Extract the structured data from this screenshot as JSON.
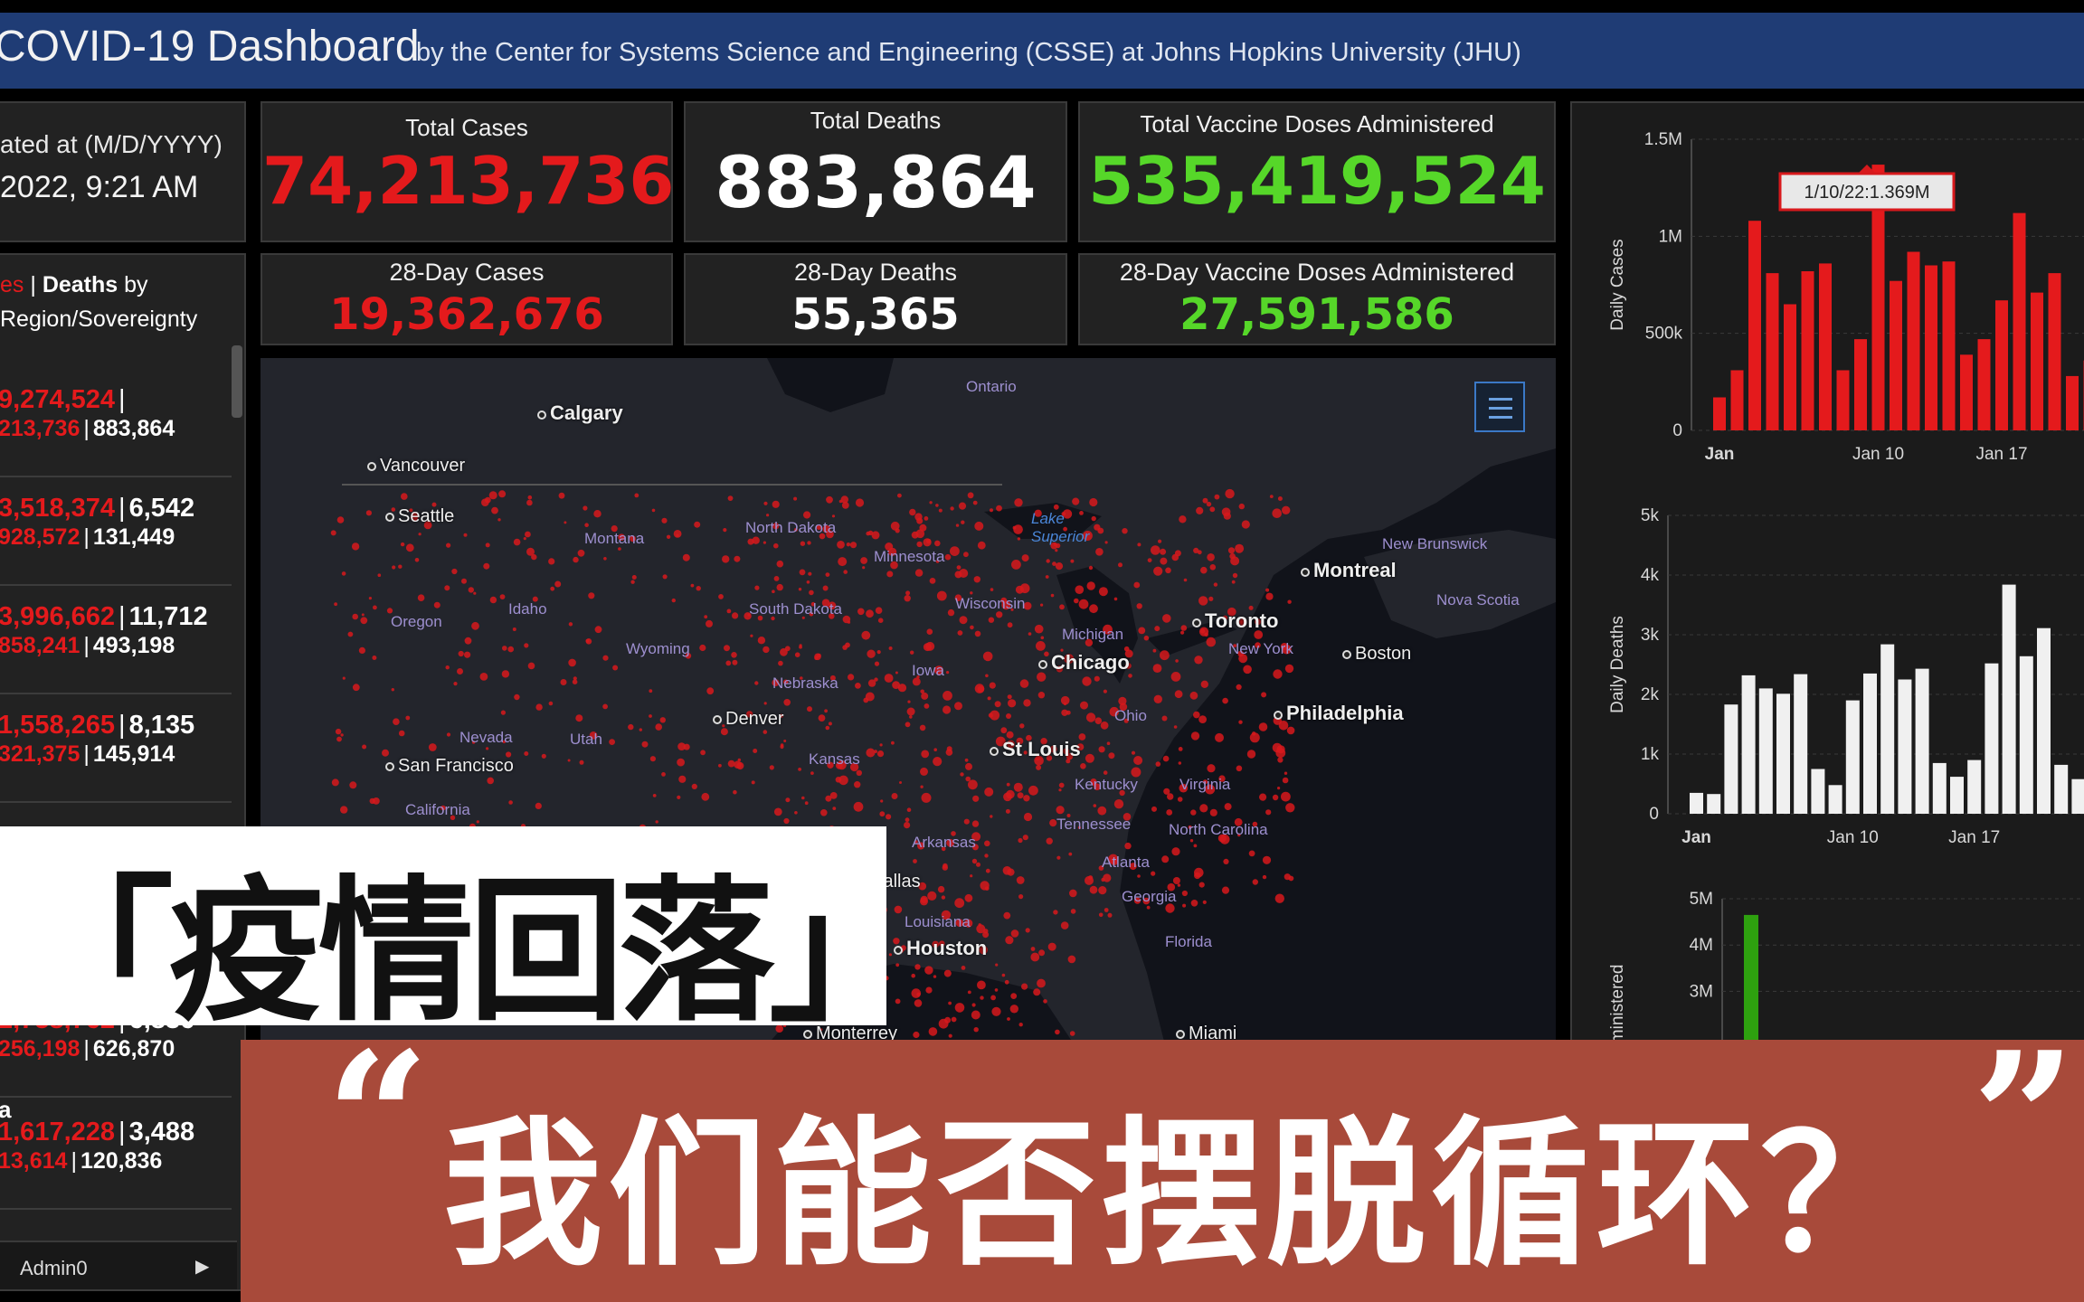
{
  "header": {
    "title": "COVID-19 Dashboard",
    "subtitle": "by the Center for Systems Science and Engineering (CSSE) at Johns Hopkins University (JHU)"
  },
  "updated": {
    "label": "ated at (M/D/YYYY)",
    "value": "2022, 9:21 AM"
  },
  "stats": {
    "total_cases": {
      "label": "Total Cases",
      "value": "74,213,736"
    },
    "total_deaths": {
      "label": "Total Deaths",
      "value": "883,864"
    },
    "total_vaccine": {
      "label": "Total Vaccine Doses Administered",
      "value": "535,419,524"
    },
    "cases_28": {
      "label": "28-Day Cases",
      "value": "19,362,676"
    },
    "deaths_28": {
      "label": "28-Day Deaths",
      "value": "55,365"
    },
    "vaccine_28": {
      "label": "28-Day Vaccine Doses Administered",
      "value": "27,591,586"
    }
  },
  "list": {
    "header_cases": "es",
    "header_sep": "|",
    "header_deaths": "Deaths",
    "header_by": "by",
    "header_region": "Region/Sovereignty",
    "rows": [
      {
        "cases_28": "9,274,524",
        "deaths_28": "",
        "cases": "213,736",
        "deaths": "883,864"
      },
      {
        "cases_28": "3,518,374",
        "deaths_28": "6,542",
        "cases": "928,572",
        "deaths": "131,449"
      },
      {
        "cases_28": "3,996,662",
        "deaths_28": "11,712",
        "cases": "858,241",
        "deaths": "493,198"
      },
      {
        "cases_28": "1,558,265",
        "deaths_28": "8,135",
        "cases": "321,375",
        "deaths": "145,914"
      },
      {
        "cases_28": "2,758,762",
        "deaths_28": "6,836",
        "cases": "256,198",
        "deaths": "626,870"
      },
      {
        "name": "a",
        "cases_28": "1,617,228",
        "deaths_28": "3,488",
        "cases": "13,614",
        "deaths": "120,836"
      }
    ],
    "footer": "Admin0"
  },
  "map": {
    "cities": [
      "Calgary",
      "Vancouver",
      "Seattle",
      "Montreal",
      "Toronto",
      "Chicago",
      "Philadelphia",
      "Denver",
      "San Francisco",
      "St Louis",
      "Houston",
      "Dallas",
      "Miami",
      "Monterrey",
      "Boston"
    ],
    "regions": [
      "Ontario",
      "Lake Superior",
      "North Dakota",
      "Montana",
      "Minnesota",
      "South Dakota",
      "Wisconsin",
      "Idaho",
      "Oregon",
      "Wyoming",
      "Nebraska",
      "Iowa",
      "Michigan",
      "New York",
      "Nevada",
      "Utah",
      "Kansas",
      "Ohio",
      "Kentucky",
      "Virginia",
      "California",
      "Arkansas",
      "Tennessee",
      "North Carolina",
      "Louisiana",
      "Georgia",
      "Florida",
      "Atlanta",
      "New Brunswick",
      "Nova Scotia"
    ],
    "list_icon": "list-icon"
  },
  "tooltip": "1/10/22:1.369M",
  "charts": {
    "cases": {
      "ylabel": "Daily Cases",
      "yticks": [
        "1.5M",
        "1M",
        "500k",
        "0"
      ],
      "xticks": [
        "Jan",
        "Jan 10",
        "Jan 17"
      ]
    },
    "deaths": {
      "ylabel": "Daily Deaths",
      "yticks": [
        "5k",
        "4k",
        "3k",
        "2k",
        "1k",
        "0"
      ],
      "xticks": [
        "Jan",
        "Jan 10",
        "Jan 17"
      ]
    },
    "vaccine": {
      "ylabel": "Administered",
      "yticks": [
        "5M",
        "4M",
        "3M"
      ]
    }
  },
  "chart_data": [
    {
      "type": "bar",
      "ylabel": "Daily Cases",
      "ylim": [
        0,
        1500000
      ],
      "color": "#e41a1c",
      "values": [
        170000,
        310000,
        1080000,
        810000,
        650000,
        820000,
        860000,
        310000,
        470000,
        1369000,
        770000,
        920000,
        850000,
        870000,
        390000,
        470000,
        670000,
        1120000,
        710000,
        810000,
        280000,
        360000
      ]
    },
    {
      "type": "bar",
      "ylabel": "Daily Deaths",
      "ylim": [
        0,
        5000
      ],
      "color": "#f0f0f0",
      "values": [
        350,
        330,
        1830,
        2320,
        2100,
        2010,
        2340,
        750,
        480,
        1900,
        2350,
        2840,
        2250,
        2430,
        850,
        620,
        900,
        2520,
        3840,
        2640,
        3110,
        820,
        580
      ]
    },
    {
      "type": "bar",
      "ylabel": "Administered",
      "ylim": [
        0,
        5000000
      ],
      "color": "#2ea10f",
      "values": [
        4650000
      ]
    }
  ],
  "overlay": {
    "headline": "「疫情回落」",
    "question": "我们能否摆脱循环？",
    "open_quote": "“",
    "close_quote": "”"
  },
  "colors": {
    "accent_red": "#e41a1c",
    "accent_green": "#56d729",
    "header_blue": "#1f3c75",
    "overlay_band": "#a84a3a"
  }
}
